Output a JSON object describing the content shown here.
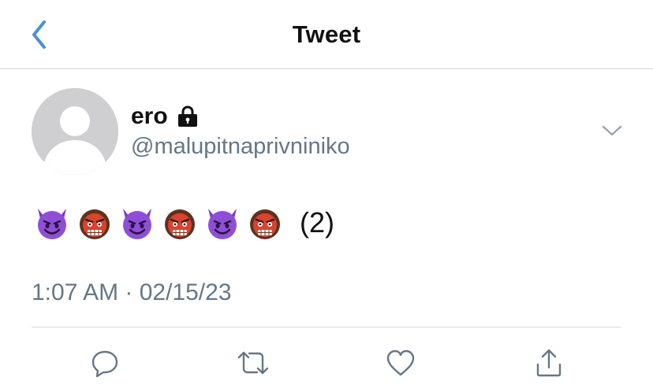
{
  "header": {
    "title": "Tweet",
    "back_icon": "chevron-left-icon",
    "accent_color": "#4a90d9"
  },
  "tweet": {
    "author": {
      "display_name": "ero",
      "handle": "@malupitnaprivniniko",
      "protected": true,
      "avatar": "default-avatar-placeholder"
    },
    "content": {
      "emojis": [
        "smiling-imp",
        "japanese-ogre",
        "smiling-imp",
        "japanese-ogre",
        "smiling-imp",
        "japanese-ogre"
      ],
      "suffix": "(2)"
    },
    "timestamp": "1:07 AM · 02/15/23"
  },
  "actions": [
    {
      "name": "reply",
      "icon": "reply-icon"
    },
    {
      "name": "retweet",
      "icon": "retweet-icon"
    },
    {
      "name": "like",
      "icon": "heart-icon"
    },
    {
      "name": "share",
      "icon": "share-icon"
    }
  ],
  "colors": {
    "secondary_text": "#657786",
    "divider": "#d6d9dc",
    "icon_gray": "#657786"
  }
}
